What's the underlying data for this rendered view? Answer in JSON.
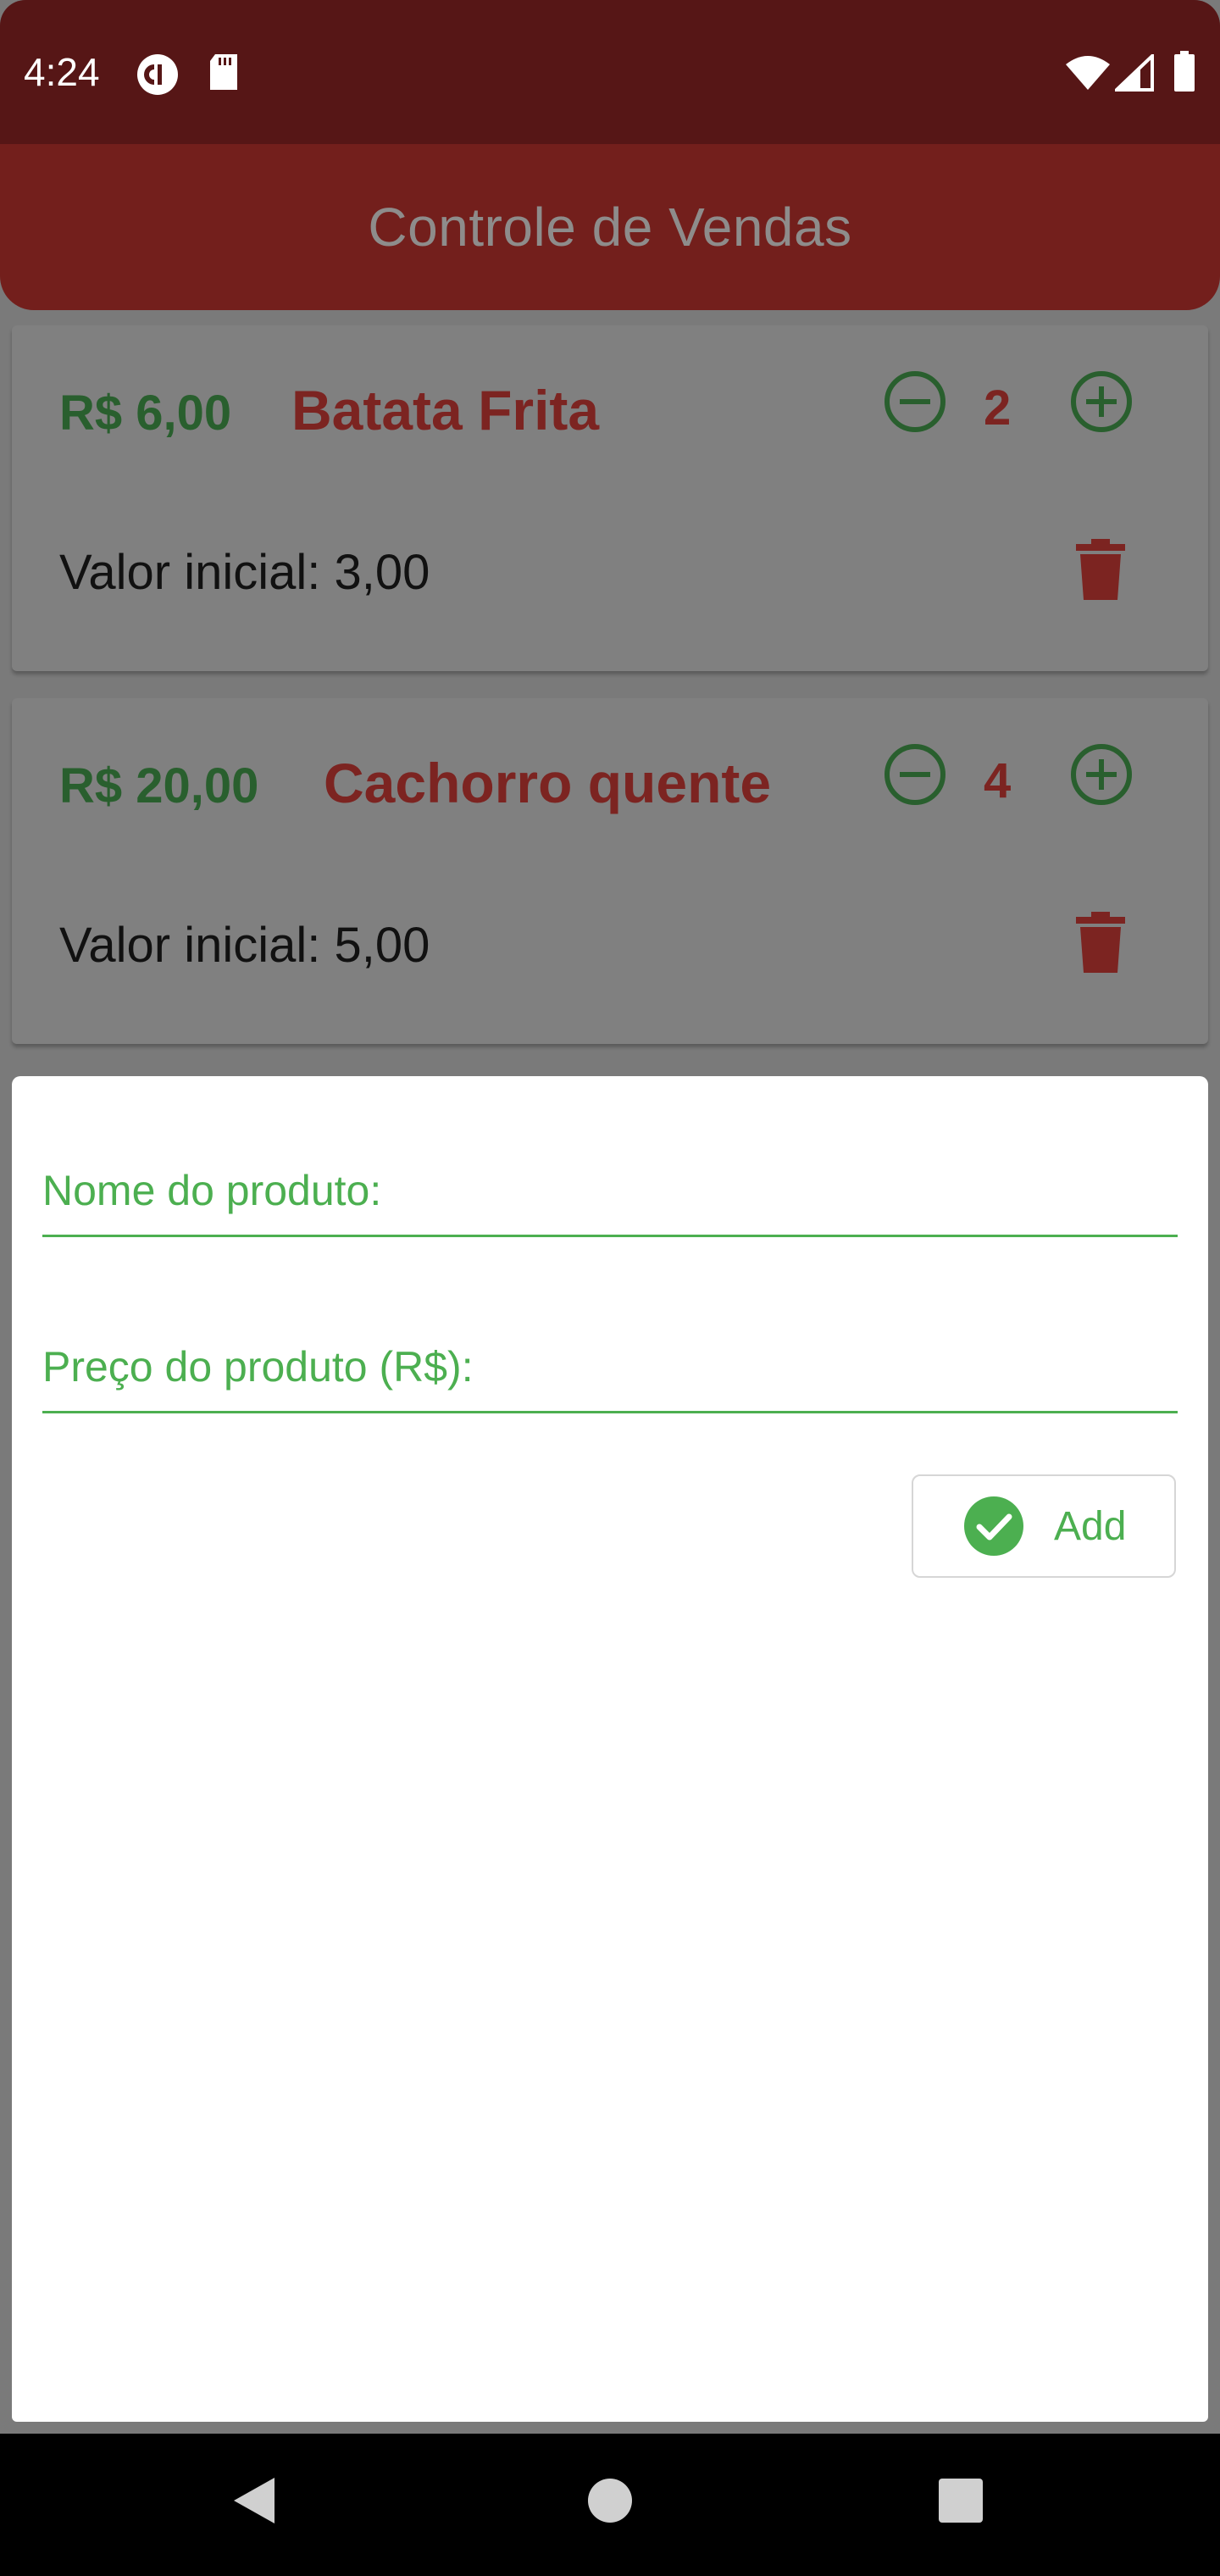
{
  "status_bar": {
    "time": "4:24",
    "left_icons": [
      "pocket-casts-icon",
      "sd-card-icon"
    ],
    "right_icons": [
      "wifi-icon",
      "signal-icon",
      "battery-icon"
    ]
  },
  "app_bar": {
    "title": "Controle de Vendas"
  },
  "items": [
    {
      "price": "R$ 6,00",
      "name": "Batata Frita",
      "quantity": "2",
      "initial_value": "Valor inicial: 3,00"
    },
    {
      "price": "R$ 20,00",
      "name": "Cachorro quente",
      "quantity": "4",
      "initial_value": "Valor inicial: 5,00"
    }
  ],
  "form": {
    "name_label": "Nome do produto:",
    "price_label": "Preço do produto (R$):",
    "name_value": "",
    "price_value": "",
    "add_label": "Add"
  },
  "nav_bar": {
    "buttons": [
      "back-icon",
      "home-icon",
      "recents-icon"
    ]
  },
  "colors": {
    "status_bar": "#561616",
    "app_bar": "#731f1c",
    "price_green": "#295f2e",
    "name_red": "#7c2421",
    "accent_green": "#4caf50",
    "scrim_gray": "#7a7a7a"
  }
}
